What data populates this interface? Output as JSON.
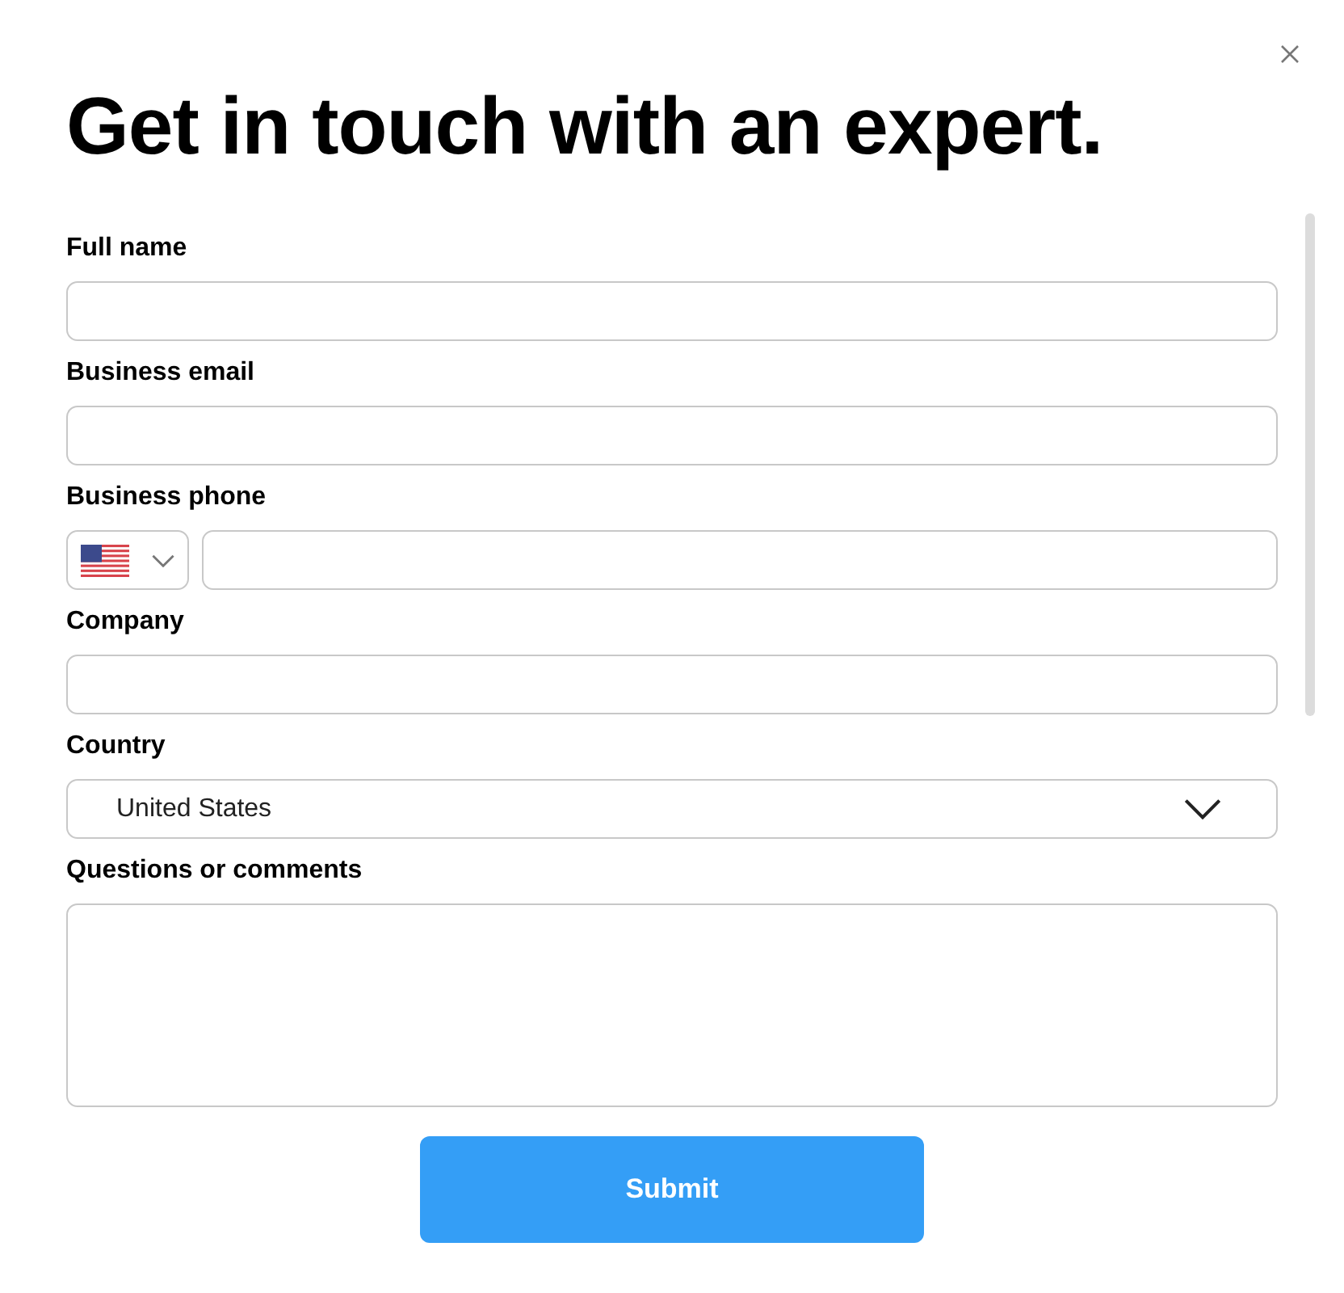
{
  "title": "Get in touch with an expert.",
  "fields": [
    {
      "kind": "text",
      "label": "Full name"
    },
    {
      "kind": "text",
      "label": "Business email"
    },
    {
      "kind": "phone",
      "label": "Business phone"
    },
    {
      "kind": "text",
      "label": "Company"
    },
    {
      "kind": "select",
      "label": "Country",
      "value": "United States"
    },
    {
      "kind": "textarea",
      "label": "Questions or comments"
    }
  ],
  "submit": "Submit"
}
